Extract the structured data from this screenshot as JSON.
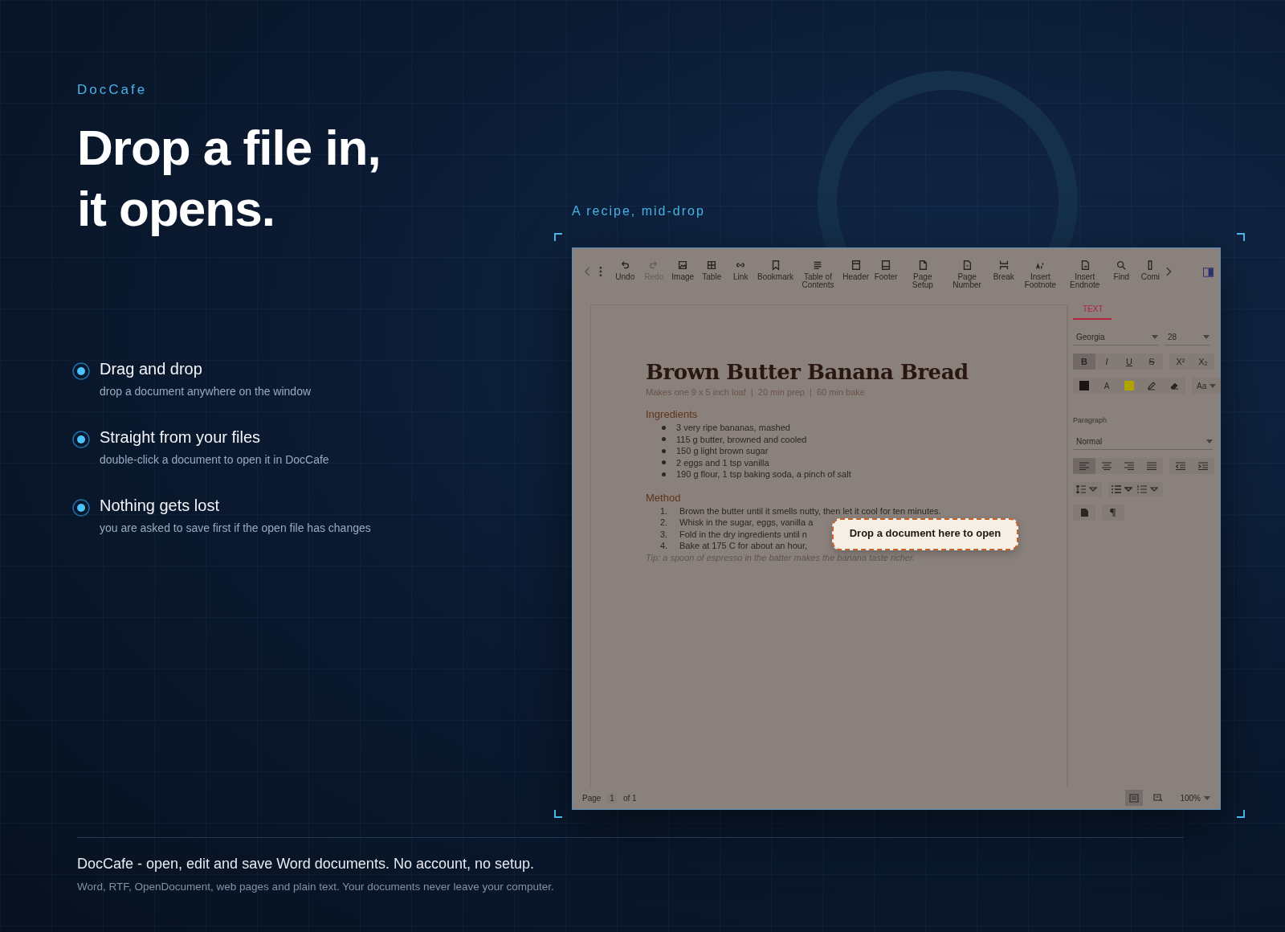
{
  "brand": "DocCafe",
  "headline": "Drop a file in, it opens.",
  "features": [
    {
      "title": "Drag and drop",
      "text": "drop a document anywhere on the window"
    },
    {
      "title": "Straight from your files",
      "text": "double-click a document to open it in DocCafe"
    },
    {
      "title": "Nothing gets lost",
      "text": "you are asked to save first if the open file has changes"
    }
  ],
  "showcase": {
    "caption": "A recipe, mid-drop",
    "app": {
      "toolbar": [
        {
          "label": "Undo",
          "disabled": false
        },
        {
          "label": "Redo",
          "disabled": true
        },
        {
          "label": "Image",
          "disabled": false
        },
        {
          "label": "Table",
          "disabled": false
        },
        {
          "label": "Link",
          "disabled": false
        },
        {
          "label": "Bookmark",
          "disabled": false
        },
        {
          "label": "Table of Contents",
          "disabled": false
        },
        {
          "label": "Header",
          "disabled": false
        },
        {
          "label": "Footer",
          "disabled": false
        },
        {
          "label": "Page Setup",
          "disabled": false
        },
        {
          "label": "Page Number",
          "disabled": false
        },
        {
          "label": "Break",
          "disabled": false
        },
        {
          "label": "Insert Footnote",
          "disabled": false
        },
        {
          "label": "Insert Endnote",
          "disabled": false
        },
        {
          "label": "Find",
          "disabled": false
        },
        {
          "label": "Comi",
          "disabled": false
        }
      ],
      "document": {
        "title": "Brown Butter Banana Bread",
        "meta": "Makes one 9 x 5 inch loaf  |  20 min prep  |  60 min bake",
        "sections": [
          {
            "heading": "Ingredients",
            "kind": "bullets",
            "items": [
              {
                "text": "3 very ripe bananas, mashed"
              },
              {
                "text": "115 g butter, browned and cooled"
              },
              {
                "text": "150 g light brown sugar"
              },
              {
                "text": "2 eggs and 1 tsp vanilla"
              },
              {
                "text": "190 g flour, 1 tsp baking soda, a pinch of salt"
              }
            ]
          },
          {
            "heading": "Method",
            "kind": "numbered",
            "items": [
              {
                "number": "1.",
                "text": "Brown the butter until it smells nutty, then let it cool for ten minutes."
              },
              {
                "number": "2.",
                "text": "Whisk in the sugar, eggs, vanilla a"
              },
              {
                "number": "3.",
                "text": "Fold in the dry ingredients until n"
              },
              {
                "number": "4.",
                "text": "Bake at 175 C for about an hour,"
              }
            ]
          }
        ],
        "tip": "Tip: a spoon of espresso in the batter makes the banana taste richer."
      },
      "drop_overlay": "Drop a document here to open",
      "sidebar": {
        "tabs": [
          {
            "label": "TEXT",
            "selected": true
          }
        ],
        "font": "Georgia",
        "size": "28",
        "format": [
          {
            "label": "B",
            "selected": true
          },
          {
            "label": "I",
            "selected": false
          },
          {
            "label": "U",
            "selected": false
          },
          {
            "label": "S",
            "selected": false
          }
        ],
        "script": [
          {
            "label": "X²",
            "selected": false
          },
          {
            "label": "X₂",
            "selected": false
          }
        ],
        "colors": [
          {
            "kind": "swatch",
            "color": "#1a1412"
          },
          {
            "kind": "letter",
            "label": "A"
          },
          {
            "kind": "swatch",
            "color": "#b0a300"
          },
          {
            "kind": "pen"
          },
          {
            "kind": "eraser"
          }
        ],
        "case": "Aa",
        "paragraph_label": "Paragraph",
        "paragraph_style": "Normal",
        "align": [
          {
            "selected": true
          },
          {
            "selected": false
          },
          {
            "selected": false
          },
          {
            "selected": false
          }
        ]
      },
      "status": {
        "page_label": "Page",
        "page": "1",
        "of": "of 1",
        "views": [
          {
            "selected": true
          },
          {
            "selected": false
          }
        ],
        "zoom": "100%"
      }
    }
  },
  "footer": {
    "title": "DocCafe - open, edit and save Word documents. No account, no setup.",
    "text": "Word, RTF, OpenDocument, web pages and plain text. Your documents never leave your computer."
  }
}
